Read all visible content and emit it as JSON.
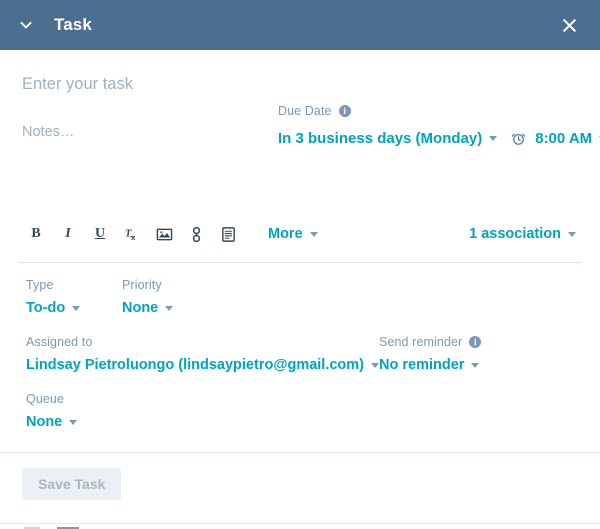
{
  "header": {
    "title": "Task",
    "collapse_icon": "chevron-down-icon",
    "close_icon": "close-icon",
    "background_color": "#4d6e8e",
    "text_color": "#ffffff"
  },
  "colors": {
    "accent_teal": "#00a4bd",
    "muted_label": "#7c98b6",
    "placeholder": "#9fb0c0",
    "divider": "#dfe3eb",
    "disabled_button_bg": "#eaf0f6",
    "disabled_button_text": "#a9b7c5"
  },
  "task": {
    "title_value": "",
    "title_placeholder": "Enter your task",
    "notes_value": "",
    "notes_placeholder": "Notes…"
  },
  "due_date": {
    "label": "Due Date",
    "info_icon": "info-icon",
    "info_glyph": "i",
    "date_value": "In 3 business days (Monday)",
    "alarm_icon": "alarm-clock-icon",
    "time_value": "8:00 AM"
  },
  "toolbar": {
    "buttons": [
      {
        "name": "bold-icon",
        "glyph": "B"
      },
      {
        "name": "italic-icon",
        "glyph": "I"
      },
      {
        "name": "underline-icon",
        "glyph": "U"
      },
      {
        "name": "clear-formatting-icon",
        "glyph": "Tx"
      },
      {
        "name": "insert-image-icon",
        "glyph": "image"
      },
      {
        "name": "insert-link-icon",
        "glyph": "link"
      },
      {
        "name": "insert-snippet-icon",
        "glyph": "document"
      }
    ],
    "more_label": "More",
    "association_label": "1 association"
  },
  "properties": {
    "type": {
      "label": "Type",
      "value": "To-do"
    },
    "priority": {
      "label": "Priority",
      "value": "None"
    },
    "assigned_to": {
      "label": "Assigned to",
      "value": "Lindsay Pietroluongo (lindsaypietro@gmail.com)"
    },
    "send_reminder": {
      "label": "Send reminder",
      "info_icon": "info-icon",
      "info_glyph": "i",
      "value": "No reminder"
    },
    "queue": {
      "label": "Queue",
      "value": "None"
    }
  },
  "footer": {
    "save_label": "Save Task",
    "save_disabled": true
  }
}
